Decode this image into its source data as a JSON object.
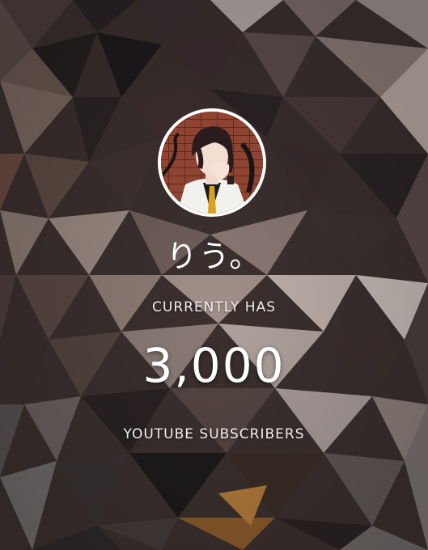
{
  "channel": {
    "name": "りう。",
    "avatar_icon": "anime-character-avatar-icon"
  },
  "milestone": {
    "caption_top": "CURRENTLY HAS",
    "count": "3,000",
    "caption_bottom": "YOUTUBE SUBSCRIBERS"
  },
  "colors": {
    "text": "#ffffff",
    "background_dark": "#2a2022",
    "background_light": "#b8aba6"
  }
}
